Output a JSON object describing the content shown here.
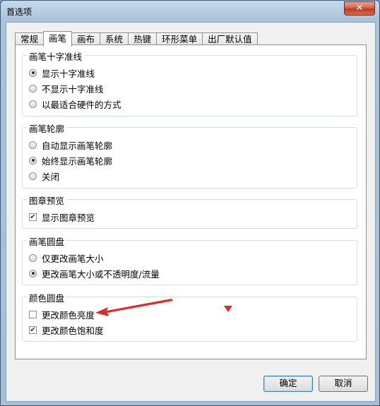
{
  "window": {
    "title": "首选项",
    "close_glyph": "✕"
  },
  "tabs": [
    "常规",
    "画笔",
    "画布",
    "系统",
    "热键",
    "环形菜单",
    "出厂默认值"
  ],
  "active_tab": "画笔",
  "groups": {
    "crosshair": {
      "title": "画笔十字准线",
      "options": [
        "显示十字准线",
        "不显示十字准线",
        "以最适合硬件的方式"
      ],
      "selected": 0
    },
    "outline": {
      "title": "画笔轮廓",
      "options": [
        "自动显示画笔轮廓",
        "始终显示画笔轮廓",
        "关闭"
      ],
      "selected": 1
    },
    "stamp": {
      "title": "图章预览",
      "options": [
        "显示图章预览"
      ],
      "checked": [
        true
      ]
    },
    "brush_puck": {
      "title": "画笔圆盘",
      "options": [
        "仅更改画笔大小",
        "更改画笔大小或不透明度/流量"
      ],
      "selected": 1
    },
    "color_puck": {
      "title": "颜色圆盘",
      "options": [
        "更改颜色亮度",
        "更改颜色饱和度"
      ],
      "checked": [
        false,
        true
      ]
    }
  },
  "buttons": {
    "ok": "确定",
    "cancel": "取消"
  },
  "colors": {
    "annotation_red": "#e02a2a"
  },
  "checkmark_glyph": "✔"
}
